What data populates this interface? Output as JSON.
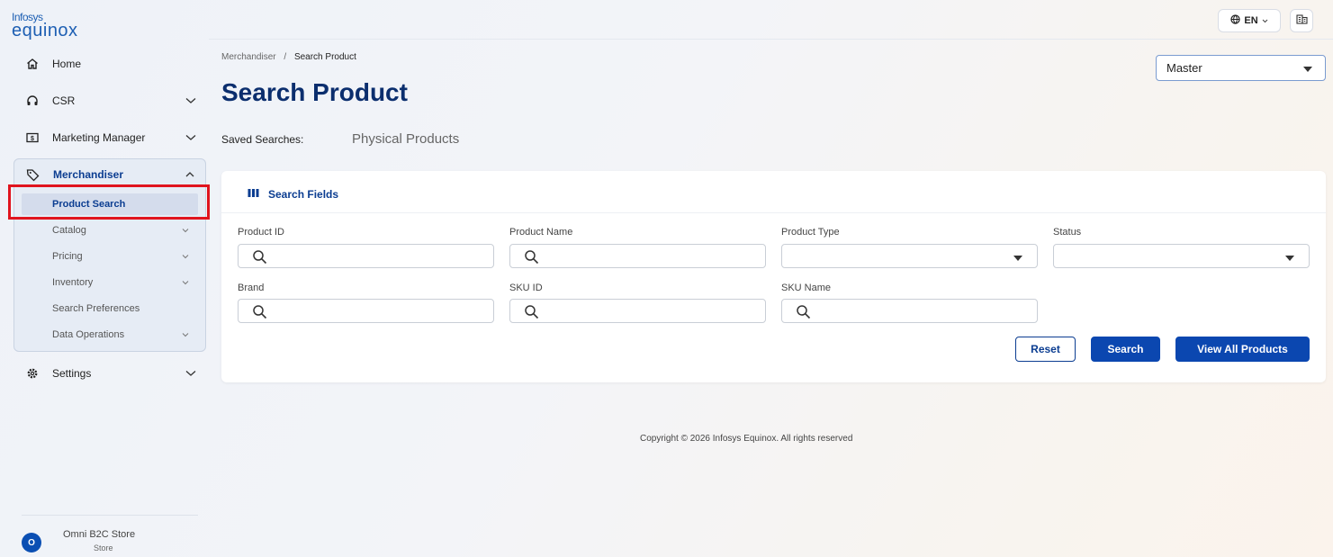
{
  "brand": {
    "line1": "Infosys",
    "line2": "equinox"
  },
  "sidebar": {
    "items": [
      {
        "label": "Home",
        "icon": "home-icon"
      },
      {
        "label": "CSR",
        "icon": "headset-icon"
      },
      {
        "label": "Marketing Manager",
        "icon": "dollar-icon"
      },
      {
        "label": "Merchandiser",
        "icon": "tag-icon"
      },
      {
        "label": "Settings",
        "icon": "gear-icon"
      }
    ],
    "merchandiser_sub": [
      {
        "label": "Product Search",
        "active": true
      },
      {
        "label": "Catalog"
      },
      {
        "label": "Pricing"
      },
      {
        "label": "Inventory"
      },
      {
        "label": "Search Preferences"
      },
      {
        "label": "Data Operations"
      }
    ],
    "store": {
      "avatar": "O",
      "name": "Omni B2C Store",
      "type": "Store"
    }
  },
  "header": {
    "language": "EN"
  },
  "breadcrumb": {
    "parent": "Merchandiser",
    "separator": "/",
    "current": "Search Product"
  },
  "page": {
    "title": "Search Product",
    "catalog_select": "Master",
    "saved_searches_label": "Saved Searches:",
    "saved_search_link": "Physical Products"
  },
  "search_card": {
    "title": "Search Fields",
    "fields": {
      "product_id": {
        "label": "Product ID",
        "value": ""
      },
      "product_name": {
        "label": "Product Name",
        "value": ""
      },
      "product_type": {
        "label": "Product Type",
        "value": ""
      },
      "status": {
        "label": "Status",
        "value": ""
      },
      "brand": {
        "label": "Brand",
        "value": ""
      },
      "sku_id": {
        "label": "SKU ID",
        "value": ""
      },
      "sku_name": {
        "label": "SKU Name",
        "value": ""
      }
    },
    "buttons": {
      "reset": "Reset",
      "search": "Search",
      "view_all": "View All Products"
    }
  },
  "footer": {
    "copyright": "Copyright © 2026 Infosys Equinox. All rights reserved"
  },
  "colors": {
    "accent": "#0b47b0",
    "title": "#0b2e6e",
    "highlight": "#e0141e"
  }
}
